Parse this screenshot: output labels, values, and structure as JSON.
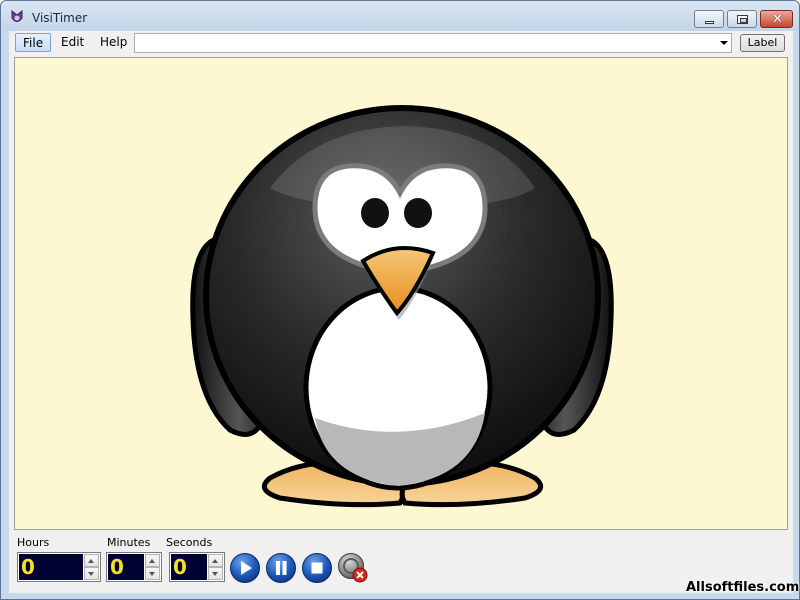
{
  "window": {
    "title": "VisiTimer",
    "close_glyph": "✕"
  },
  "menu": {
    "items": [
      {
        "label": "File",
        "active": true
      },
      {
        "label": "Edit",
        "active": false
      },
      {
        "label": "Help",
        "active": false
      }
    ]
  },
  "toolbar": {
    "label_combo_value": "",
    "label_button": "Label"
  },
  "display": {
    "image": "penguin-cartoon",
    "background_color": "#fef8d2"
  },
  "timer": {
    "hours_label": "Hours",
    "minutes_label": "Minutes",
    "seconds_label": "Seconds",
    "hours": "0",
    "minutes": "0",
    "seconds": "0",
    "value_color": "#f4df2a",
    "field_color": "#000033"
  },
  "buttons": {
    "play": "play-icon",
    "pause": "pause-icon",
    "stop": "stop-icon",
    "reset": "reset-icon"
  },
  "watermark": "Allsoftfiles.com"
}
